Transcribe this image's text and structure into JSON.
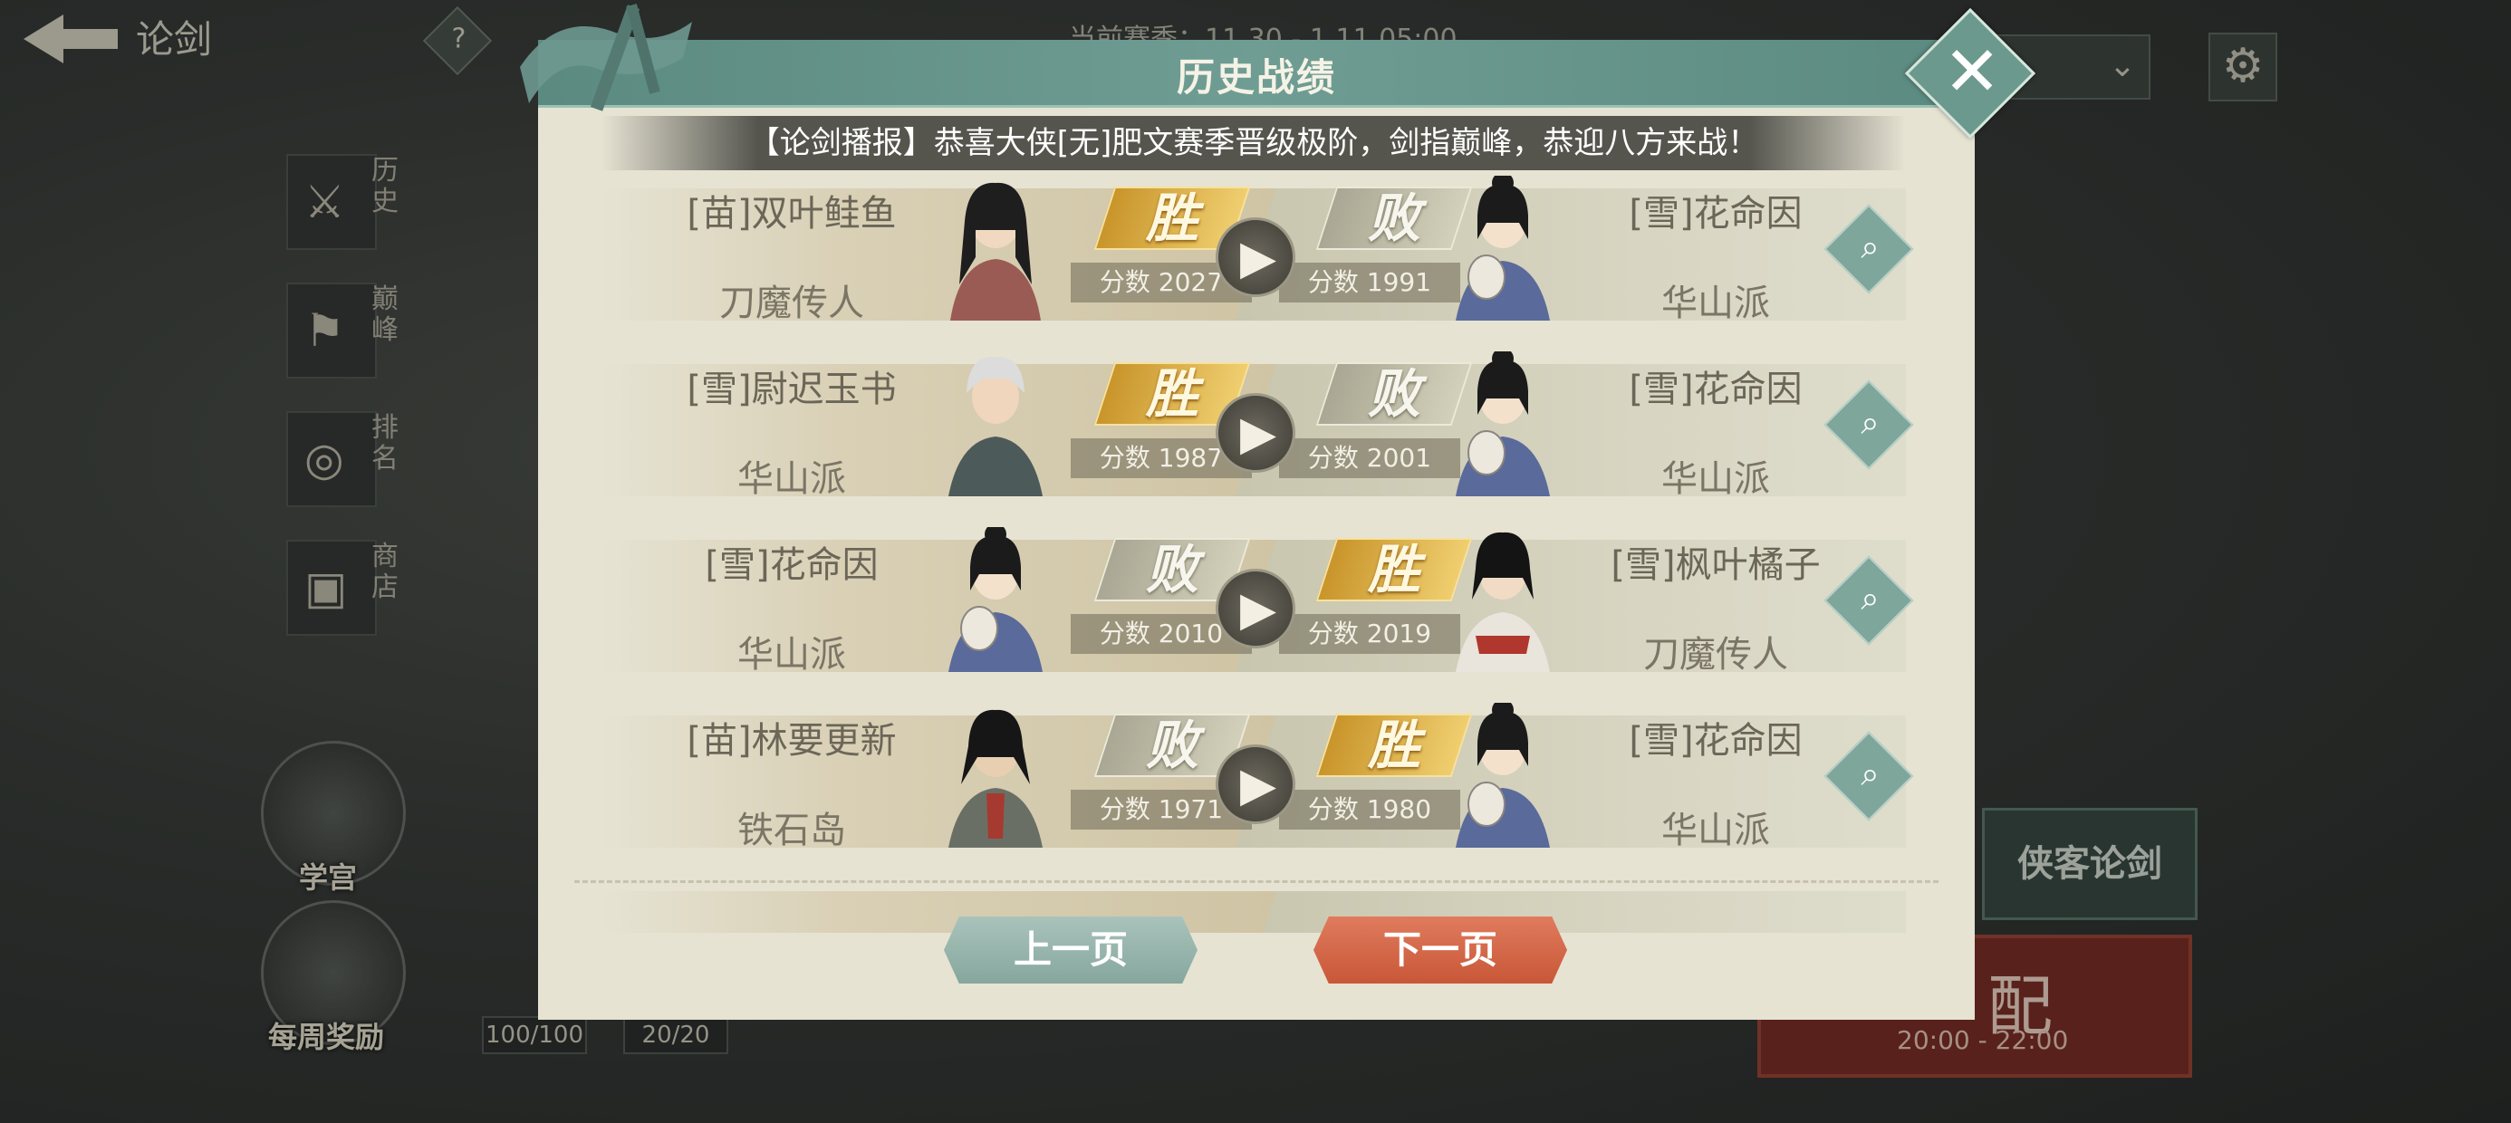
{
  "hud": {
    "page_name": "论剑",
    "help_label": "?",
    "season_text": "当前赛季：11.30 - 1.11 05:00",
    "select_value": "",
    "side_nav": [
      {
        "label": "历史",
        "icon": "crossed-swords-icon"
      },
      {
        "label": "巅峰",
        "icon": "flag-icon"
      },
      {
        "label": "排名",
        "icon": "rank-badge-icon"
      },
      {
        "label": "商店",
        "icon": "shop-icon"
      }
    ],
    "xuegong_label": "学宫",
    "weekly_reward_label": "每周奖励",
    "stat_a": "100/100",
    "stat_b": "20/20",
    "xiake_label": "侠客论剑",
    "match_label": "配",
    "match_time": "20:00 - 22:00"
  },
  "modal": {
    "title": "历史战绩",
    "close_label": "✕",
    "broadcast": "【论剑播报】恭喜大侠[无]肥文赛季晋级极阶，剑指巅峰，恭迎八方来战！",
    "battles": [
      {
        "left": {
          "name": "[苗]双叶鲑鱼",
          "school": "刀魔传人",
          "result": "胜",
          "score": "分数 2027"
        },
        "right": {
          "name": "[雪]花命因",
          "school": "华山派",
          "result": "败",
          "score": "分数 1991"
        }
      },
      {
        "left": {
          "name": "[雪]尉迟玉书",
          "school": "华山派",
          "result": "胜",
          "score": "分数 1987"
        },
        "right": {
          "name": "[雪]花命因",
          "school": "华山派",
          "result": "败",
          "score": "分数 2001"
        }
      },
      {
        "left": {
          "name": "[雪]花命因",
          "school": "华山派",
          "result": "败",
          "score": "分数 2010"
        },
        "right": {
          "name": "[雪]枫叶橘子",
          "school": "刀魔传人",
          "result": "胜",
          "score": "分数 2019"
        }
      },
      {
        "left": {
          "name": "[苗]林要更新",
          "school": "铁石岛",
          "result": "败",
          "score": "分数 1971"
        },
        "right": {
          "name": "[雪]花命因",
          "school": "华山派",
          "result": "胜",
          "score": "分数 1980"
        }
      }
    ],
    "prev_label": "上一页",
    "next_label": "下一页"
  },
  "colors": {
    "header": "#6f9d93",
    "win": "#e8b84a",
    "lose": "#c3c0aa",
    "next_button": "#d4664a",
    "prev_button": "#9ab8af"
  }
}
